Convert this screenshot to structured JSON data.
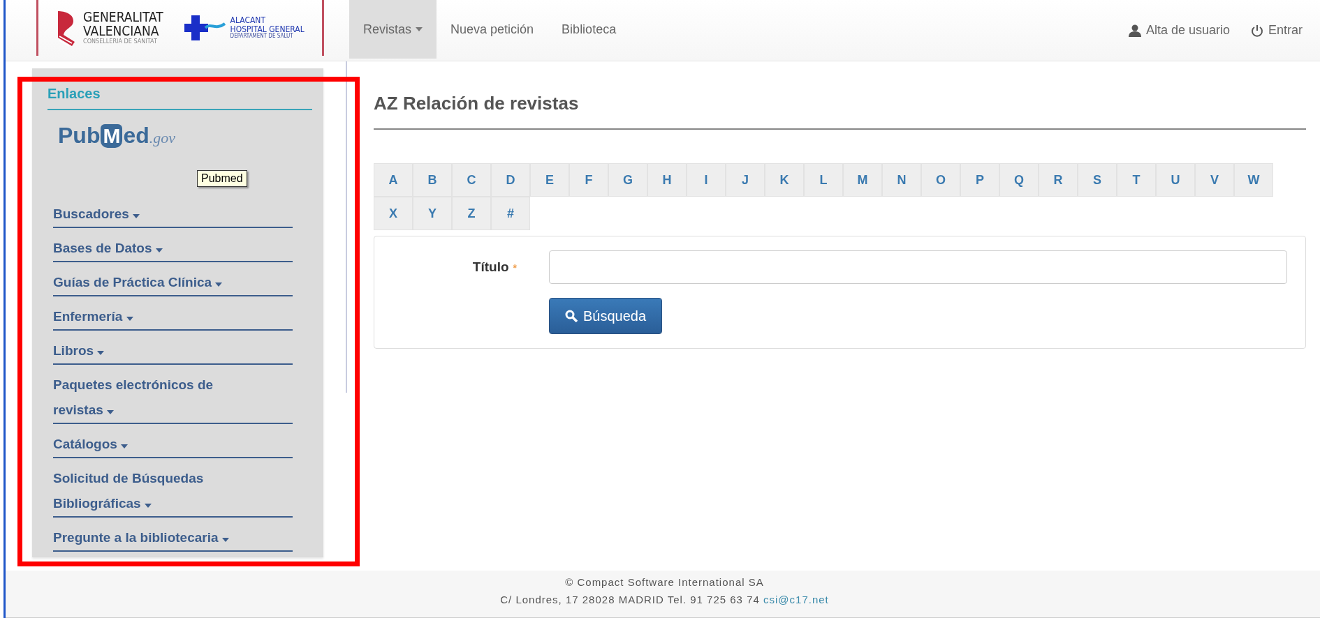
{
  "header": {
    "logo_generalitat": {
      "line1": "GENERALITAT",
      "line2": "VALENCIANA",
      "subtitle": "CONSELLERIA DE SANITAT"
    },
    "logo_hospital": {
      "line1": "ALACANT",
      "line2": "HOSPITAL GENERAL",
      "line3": "DEPARTAMENT DE SALUT"
    }
  },
  "nav": {
    "items": [
      {
        "label": "Revistas",
        "selected": true,
        "dropdown": true
      },
      {
        "label": "Nueva petición",
        "selected": false,
        "dropdown": false
      },
      {
        "label": "Biblioteca",
        "selected": false,
        "dropdown": false
      }
    ],
    "right": [
      {
        "kind": "user",
        "label": "Alta de usuario"
      },
      {
        "kind": "power",
        "label": "Entrar"
      }
    ]
  },
  "sidebar": {
    "title": "Enlaces",
    "pubmed_logo": {
      "pub": "Pub",
      "m": "M",
      "ed": "ed",
      "gov": ".gov"
    },
    "tooltip": "Pubmed",
    "items": [
      {
        "label": "Buscadores"
      },
      {
        "label": "Bases de Datos"
      },
      {
        "label": "Guías de Práctica Clínica"
      },
      {
        "label": "Enfermería"
      },
      {
        "label": "Libros"
      },
      {
        "label": "Paquetes electrónicos de revistas"
      },
      {
        "label": "Catálogos"
      },
      {
        "label": "Solicitud de Búsquedas Bibliográficas"
      },
      {
        "label": "Pregunte a la bibliotecaria"
      }
    ]
  },
  "main": {
    "title": "AZ Relación de revistas",
    "letters": [
      "A",
      "B",
      "C",
      "D",
      "E",
      "F",
      "G",
      "H",
      "I",
      "J",
      "K",
      "L",
      "M",
      "N",
      "O",
      "P",
      "Q",
      "R",
      "S",
      "T",
      "U",
      "V",
      "W",
      "X",
      "Y",
      "Z",
      "#"
    ],
    "form": {
      "label": "Título",
      "required_mark": "*",
      "button": "Búsqueda"
    }
  },
  "footer": {
    "line1": "© Compact Software International SA",
    "line2": "C/ Londres, 17 28028 MADRID Tel. 91 725 63 74",
    "email": "csi@c17.net"
  }
}
